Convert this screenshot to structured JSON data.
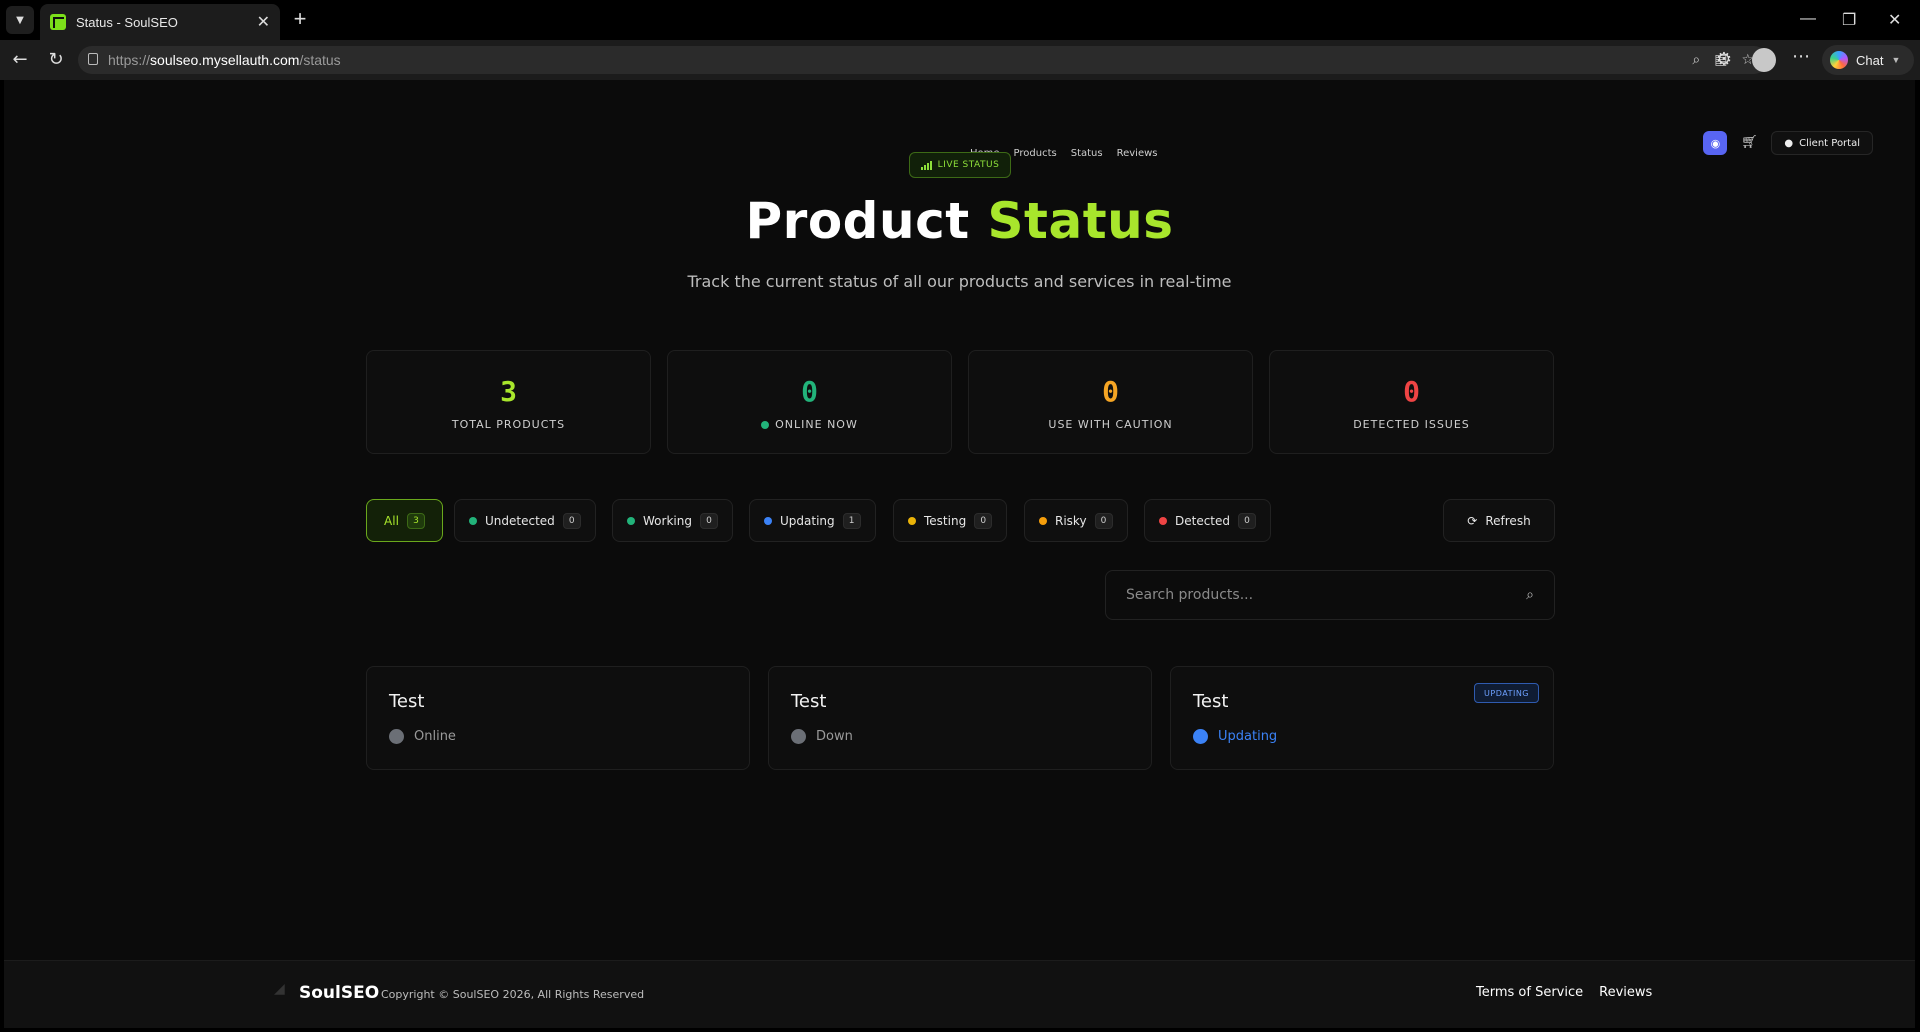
{
  "browser": {
    "tab_title": "Status - SoulSEO",
    "url_prefix": "https://",
    "url_host": "soulseo.mysellauth.com",
    "url_path": "/status",
    "chat_label": "Chat"
  },
  "nav": {
    "links": [
      "Home",
      "Products",
      "Status",
      "Reviews"
    ],
    "client_portal": "Client Portal"
  },
  "hero": {
    "badge": "LIVE STATUS",
    "title_part1": "Product",
    "title_part2": "Status",
    "subtitle": "Track the current status of all our products and services in real-time"
  },
  "stats": [
    {
      "value": "3",
      "label": "TOTAL PRODUCTS",
      "color": "#a8e62c"
    },
    {
      "value": "0",
      "label": "ONLINE NOW",
      "color": "#22b37a"
    },
    {
      "value": "0",
      "label": "USE WITH CAUTION",
      "color": "#f5a524"
    },
    {
      "value": "0",
      "label": "DETECTED ISSUES",
      "color": "#ef4444"
    }
  ],
  "filters": [
    {
      "label": "All",
      "count": "3"
    },
    {
      "label": "Undetected",
      "count": "0",
      "color": "#22b37a"
    },
    {
      "label": "Working",
      "count": "0",
      "color": "#22b37a"
    },
    {
      "label": "Updating",
      "count": "1",
      "color": "#3b82f6"
    },
    {
      "label": "Testing",
      "count": "0",
      "color": "#eab308"
    },
    {
      "label": "Risky",
      "count": "0",
      "color": "#f59e0b"
    },
    {
      "label": "Detected",
      "count": "0",
      "color": "#ef4444"
    }
  ],
  "refresh_label": "Refresh",
  "search": {
    "placeholder": "Search products..."
  },
  "products": [
    {
      "name": "Test",
      "status": "Online"
    },
    {
      "name": "Test",
      "status": "Down"
    },
    {
      "name": "Test",
      "status": "Updating",
      "badge": "UPDATING",
      "status_color": "#3b82f6"
    }
  ],
  "footer": {
    "brand": "SoulSEO",
    "copyright": "Copyright © SoulSEO 2026, All Rights Reserved",
    "links": [
      "Terms of Service",
      "Reviews"
    ]
  }
}
